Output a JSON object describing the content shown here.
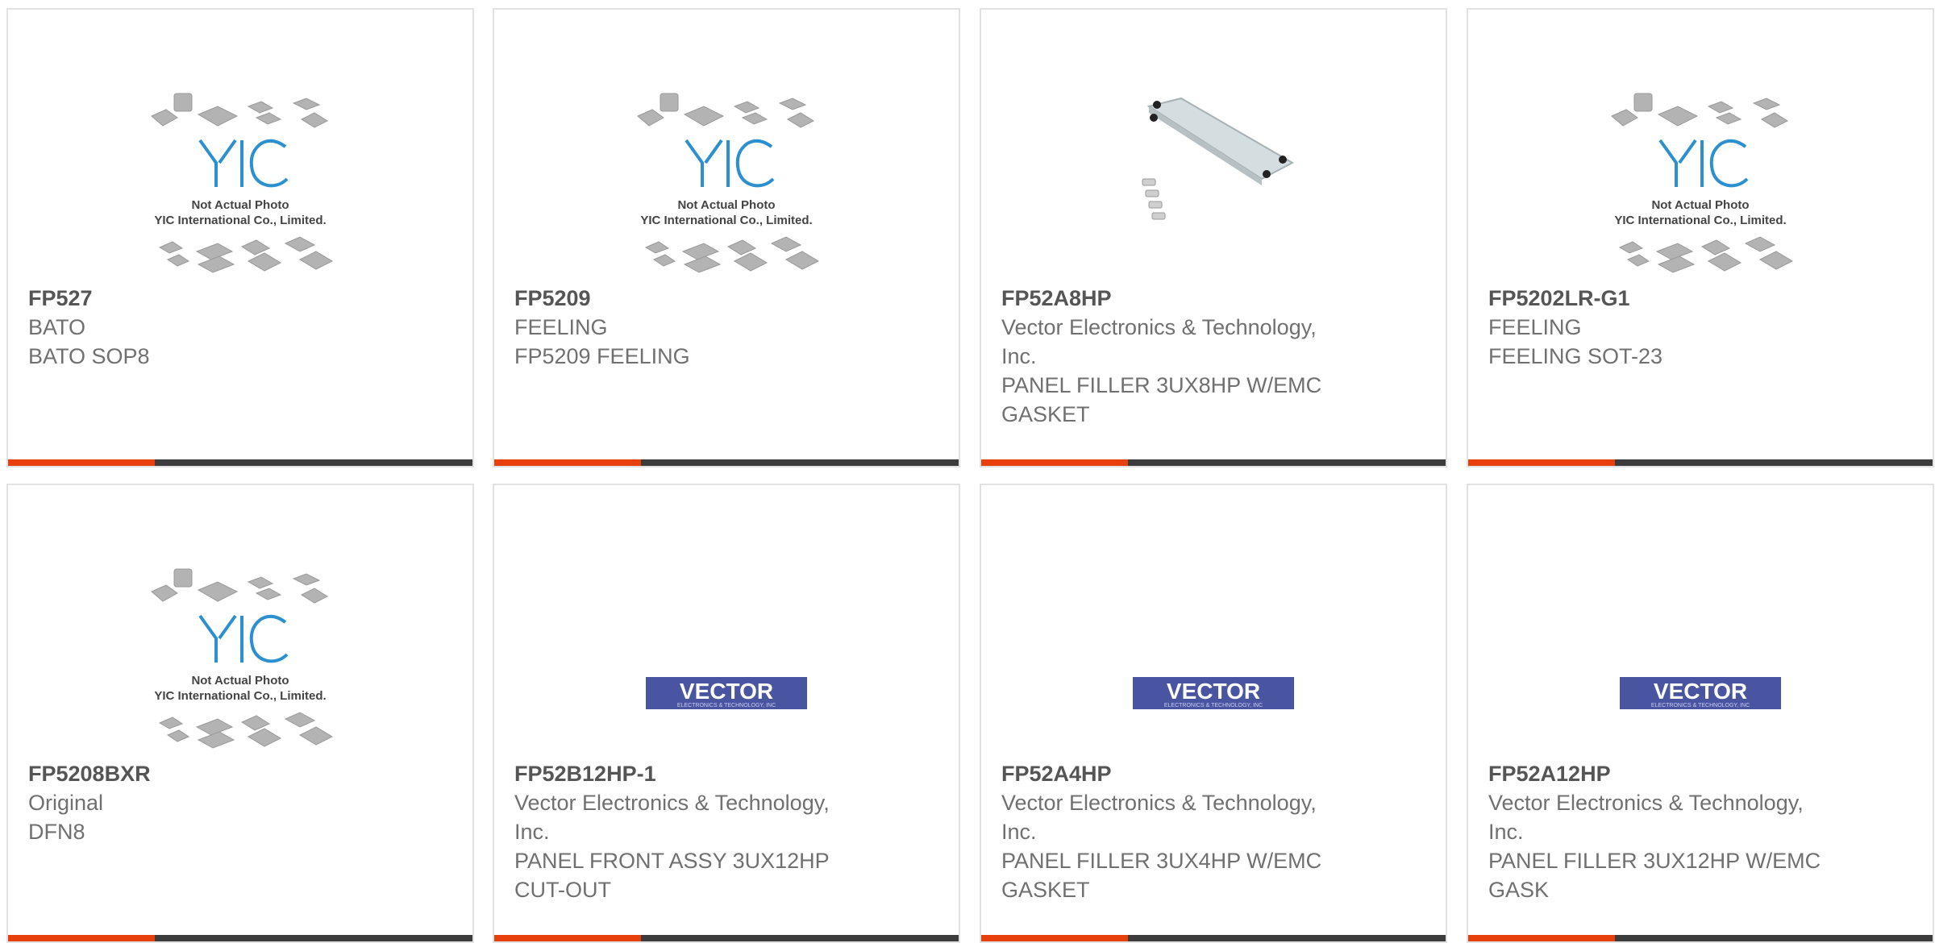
{
  "products": [
    {
      "part": "FP527",
      "maker": "BATO",
      "desc": "BATO SOP8",
      "image": "yic-placeholder",
      "placeholder_line1": "Not Actual Photo",
      "placeholder_line2": "YIC International Co., Limited.",
      "logo_text": "YIC"
    },
    {
      "part": "FP5209",
      "maker": "FEELING",
      "desc": "FP5209 FEELING",
      "image": "yic-placeholder",
      "placeholder_line1": "Not Actual Photo",
      "placeholder_line2": "YIC International Co., Limited.",
      "logo_text": "YIC"
    },
    {
      "part": "FP52A8HP",
      "maker": "Vector Electronics & Technology, Inc.",
      "desc": "PANEL FILLER 3UX8HP W/EMC GASKET",
      "image": "panel-photo"
    },
    {
      "part": "FP5202LR-G1",
      "maker": "FEELING",
      "desc": "FEELING SOT-23",
      "image": "yic-placeholder",
      "placeholder_line1": "Not Actual Photo",
      "placeholder_line2": "YIC International Co., Limited.",
      "logo_text": "YIC"
    },
    {
      "part": "FP5208BXR",
      "maker": "Original",
      "desc": "DFN8",
      "image": "yic-placeholder",
      "placeholder_line1": "Not Actual Photo",
      "placeholder_line2": "YIC International Co., Limited.",
      "logo_text": "YIC"
    },
    {
      "part": "FP52B12HP-1",
      "maker": "Vector Electronics & Technology, Inc.",
      "desc": "PANEL FRONT ASSY 3UX12HP CUT-OUT",
      "image": "vector-logo",
      "logo_text": "VECTOR",
      "logo_sub": "ELECTRONICS & TECHNOLOGY, INC"
    },
    {
      "part": "FP52A4HP",
      "maker": "Vector Electronics & Technology, Inc.",
      "desc": "PANEL FILLER 3UX4HP W/EMC GASKET",
      "image": "vector-logo",
      "logo_text": "VECTOR",
      "logo_sub": "ELECTRONICS & TECHNOLOGY, INC"
    },
    {
      "part": "FP52A12HP",
      "maker": "Vector Electronics & Technology, Inc.",
      "desc": "PANEL FILLER 3UX12HP W/EMC GASK",
      "image": "vector-logo",
      "logo_text": "VECTOR",
      "logo_sub": "ELECTRONICS & TECHNOLOGY, INC"
    }
  ],
  "colors": {
    "accent": "#e8400c",
    "bar": "#3c3c3c",
    "border": "#e2e2e2",
    "part_text": "#555555",
    "body_text": "#707070",
    "yic_blue": "#2b8fd0",
    "vector_blue": "#4a55a2"
  }
}
